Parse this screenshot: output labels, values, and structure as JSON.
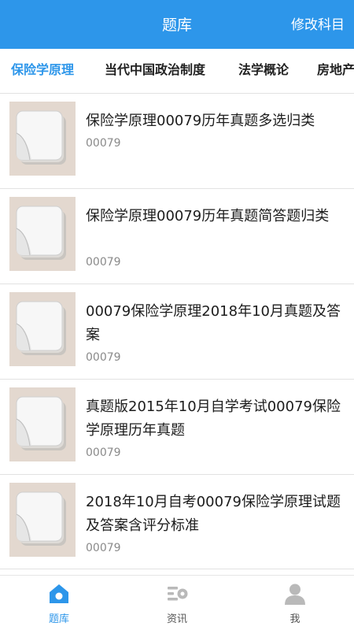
{
  "header": {
    "title": "题库",
    "action_label": "修改科目"
  },
  "tabs": [
    "保险学原理",
    "当代中国政治制度",
    "法学概论",
    "房地产"
  ],
  "active_tab": 0,
  "items": [
    {
      "title": "保险学原理00079历年真题多选归类",
      "code": "00079"
    },
    {
      "title": "保险学原理00079历年真题简答题归类",
      "code": "00079"
    },
    {
      "title": "00079保险学原理2018年10月真题及答案",
      "code": "00079"
    },
    {
      "title": "真题版2015年10月自学考试00079保险学原理历年真题",
      "code": "00079"
    },
    {
      "title": "2018年10月自考00079保险学原理试题及答案含评分标准",
      "code": "00079"
    }
  ],
  "bottom_nav": [
    {
      "label": "题库",
      "icon": "home-icon",
      "active": true
    },
    {
      "label": "资讯",
      "icon": "news-icon",
      "active": false
    },
    {
      "label": "我",
      "icon": "person-icon",
      "active": false
    }
  ],
  "colors": {
    "accent": "#2d96ea",
    "thumb_bg": "#e3d8cf"
  }
}
